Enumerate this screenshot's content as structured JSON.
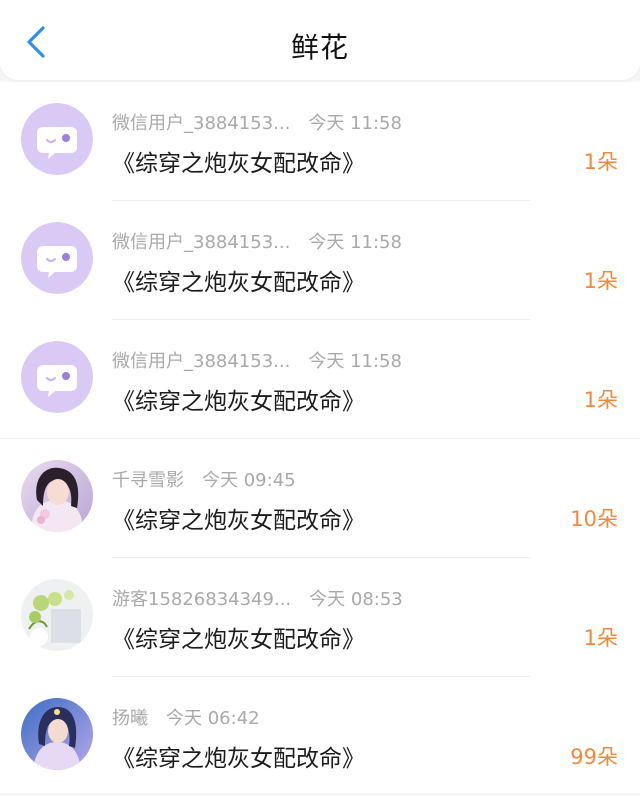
{
  "header": {
    "title": "鲜花"
  },
  "colors": {
    "accent_blue": "#2f8ff0",
    "count_orange": "#f0883e",
    "default_avatar": "#d9c9f5"
  },
  "records": [
    {
      "user": "微信用户_3884153...",
      "time": "今天 11:58",
      "book": "《综穿之炮灰女配改命》",
      "count": "1朵",
      "avatar": "default-avatar-icon"
    },
    {
      "user": "微信用户_3884153...",
      "time": "今天 11:58",
      "book": "《综穿之炮灰女配改命》",
      "count": "1朵",
      "avatar": "default-avatar-icon"
    },
    {
      "user": "微信用户_3884153...",
      "time": "今天 11:58",
      "book": "《综穿之炮灰女配改命》",
      "count": "1朵",
      "avatar": "default-avatar-icon"
    },
    {
      "user": "千寻雪影",
      "time": "今天 09:45",
      "book": "《综穿之炮灰女配改命》",
      "count": "10朵",
      "avatar": "girl-portrait-avatar"
    },
    {
      "user": "游客15826834349...",
      "time": "今天 08:53",
      "book": "《综穿之炮灰女配改命》",
      "count": "1朵",
      "avatar": "flower-photo-avatar"
    },
    {
      "user": "扬曦",
      "time": "今天 06:42",
      "book": "《综穿之炮灰女配改命》",
      "count": "99朵",
      "avatar": "fantasy-girl-avatar"
    }
  ]
}
